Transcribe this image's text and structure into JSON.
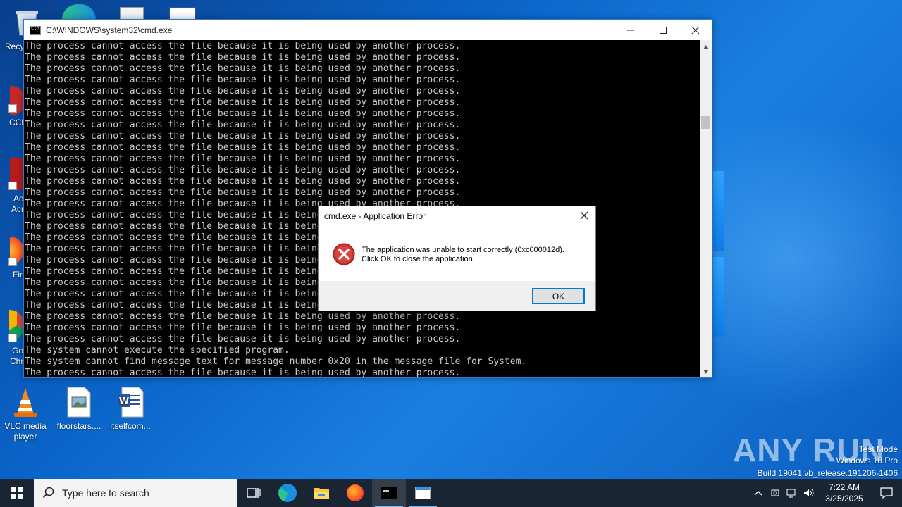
{
  "desktop": {
    "left_labels": [
      "Recy",
      "CCl",
      "Ad",
      "Acr",
      "Fir",
      "Go",
      "Chr"
    ],
    "icons": [
      {
        "label": "VLC media player",
        "icon": "vlc-icon"
      },
      {
        "label": "floorstars....",
        "icon": "image-file-icon"
      },
      {
        "label": "itselfcom...",
        "icon": "word-doc-icon"
      }
    ]
  },
  "cmd": {
    "title": "C:\\WINDOWS\\system32\\cmd.exe",
    "lines": [
      "The process cannot access the file because it is being used by another process.",
      "The process cannot access the file because it is being used by another process.",
      "The process cannot access the file because it is being used by another process.",
      "The process cannot access the file because it is being used by another process.",
      "The process cannot access the file because it is being used by another process.",
      "The process cannot access the file because it is being used by another process.",
      "The process cannot access the file because it is being used by another process.",
      "The process cannot access the file because it is being used by another process.",
      "The process cannot access the file because it is being used by another process.",
      "The process cannot access the file because it is being used by another process.",
      "The process cannot access the file because it is being used by another process.",
      "The process cannot access the file because it is being used by another process.",
      "The process cannot access the file because it is being used by another process.",
      "The process cannot access the file because it is being used by another process.",
      "The process cannot access the file because it is being used by another process.",
      "The process cannot access the file because it is being used by another process.",
      "The process cannot access the file because it is being used by another process.",
      "The process cannot access the file because it is being used by another process.",
      "The process cannot access the file because it is being used by another process.",
      "The process cannot access the file because it is being used by another process.",
      "The process cannot access the file because it is being used by another process.",
      "The process cannot access the file because it is being used by another process.",
      "The process cannot access the file because it is being used by another process.",
      "The process cannot access the file because it is being used by another process.",
      "The process cannot access the file because it is being used by another process.",
      "The process cannot access the file because it is being used by another process.",
      "The process cannot access the file because it is being used by another process.",
      "The system cannot execute the specified program.",
      "The system cannot find message text for message number 0x20 in the message file for System.",
      "The process cannot access the file because it is being used by another process."
    ]
  },
  "dialog": {
    "title": "cmd.exe - Application Error",
    "message_line1": "The application was unable to start correctly (0xc000012d).",
    "message_line2": "Click OK to close the application.",
    "ok_label": "OK"
  },
  "watermark": {
    "brand": "ANY RUN",
    "line1": "Test Mode",
    "line2": "Windows 10 Pro",
    "line3": "Build 19041.vb_release.191206-1406"
  },
  "taskbar": {
    "search_placeholder": "Type here to search",
    "time": "7:22 AM",
    "date": "3/25/2025"
  }
}
